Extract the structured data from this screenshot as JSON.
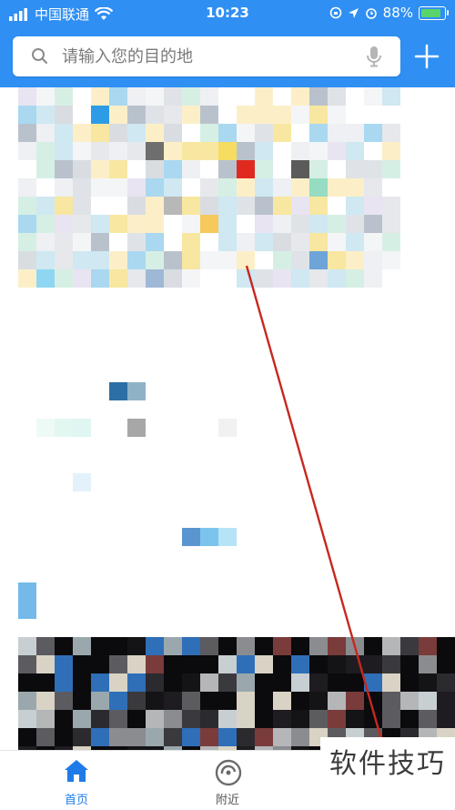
{
  "status_bar": {
    "carrier": "中国联通",
    "time": "10:23",
    "battery": "88%",
    "battery_level": 0.88
  },
  "search": {
    "placeholder": "请输入您的目的地"
  },
  "tabs": [
    {
      "label": "首页",
      "active": true
    },
    {
      "label": "附近",
      "active": false
    }
  ],
  "watermark": "软件技巧",
  "colors": {
    "header_blue": "#2f8ff3",
    "active_tab": "#1f7be8",
    "annotation_line": "#c8281e"
  }
}
